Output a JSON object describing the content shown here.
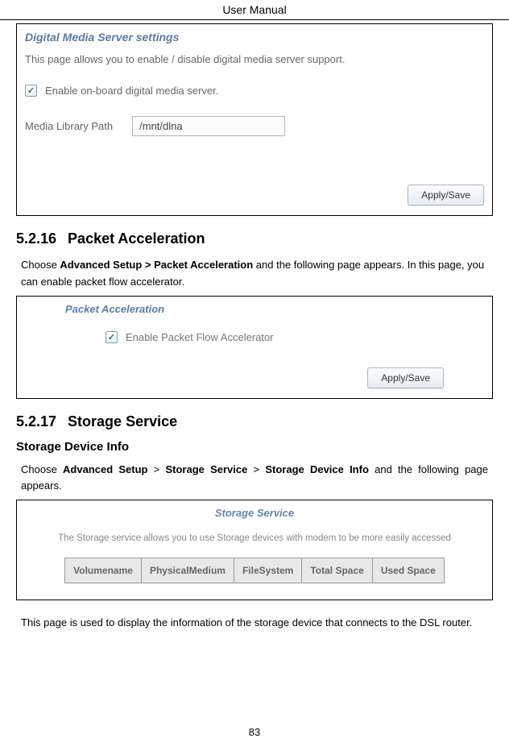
{
  "header": {
    "title": "User Manual"
  },
  "dms": {
    "title": "Digital Media Server settings",
    "desc": "This page allows you to enable / disable digital media server support.",
    "check_mark": "✓",
    "check_label": "Enable on-board digital media server.",
    "lib_label": "Media Library Path",
    "lib_value": "/mnt/dlna",
    "apply": "Apply/Save"
  },
  "sec16": {
    "num": "5.2.16",
    "title": "Packet Acceleration",
    "text_pre": "Choose ",
    "bold1": "Advanced Setup > Packet Acceleration",
    "text_mid": " and the following page appears. In this page, you can enable packet flow accelerator."
  },
  "pa": {
    "title": "Packet Acceleration",
    "check_mark": "✓",
    "check_label": "Enable Packet Flow Accelerator",
    "apply": "Apply/Save"
  },
  "sec17": {
    "num": "5.2.17",
    "title": "Storage Service",
    "sub": "Storage Device Info",
    "text_pre": "Choose ",
    "bold1": "Advanced Setup",
    "gt1": " > ",
    "bold2": "Storage Service",
    "gt2": " > ",
    "bold3": "Storage Device Info",
    "text_mid": " and the following page appears."
  },
  "storage": {
    "title": "Storage Service",
    "desc": "The Storage service allows you to use Storage devices with modem to be more easily accessed",
    "cols": [
      "Volumename",
      "PhysicalMedium",
      "FileSystem",
      "Total Space",
      "Used Space"
    ]
  },
  "post_storage": "This page is used to display the information of the storage device that connects to the DSL router.",
  "page_num": "83"
}
